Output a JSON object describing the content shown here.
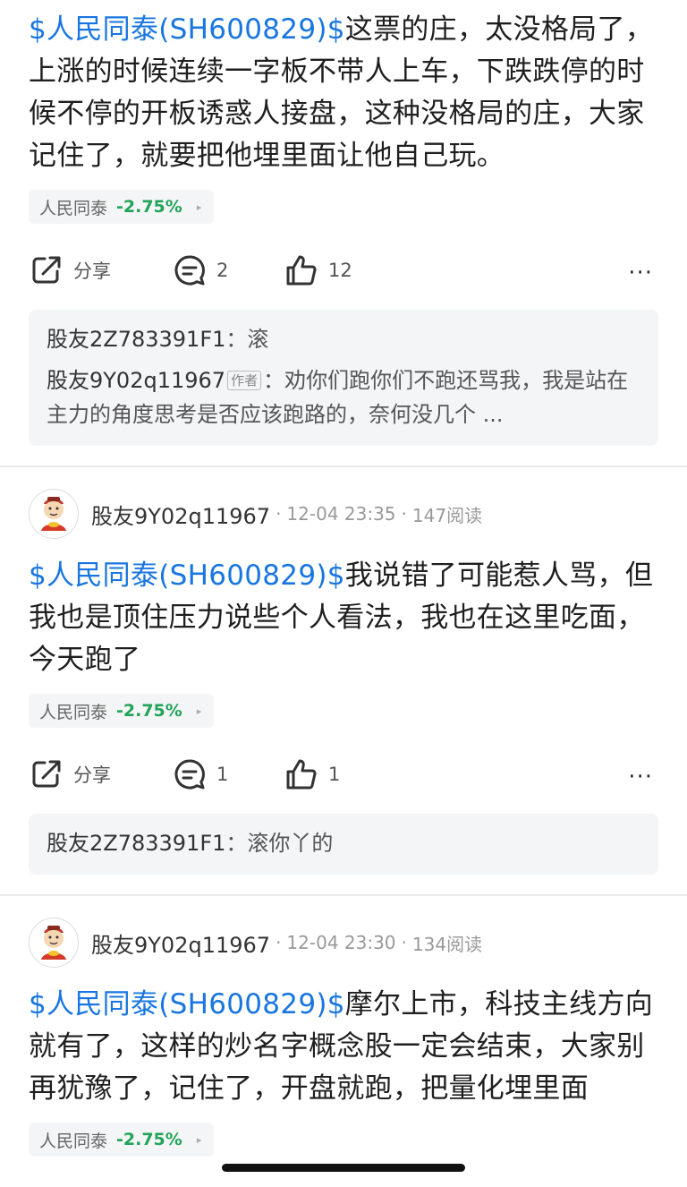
{
  "posts": [
    {
      "stock_tag": "$人民同泰(SH600829)$",
      "body": "这票的庄，太没格局了，上涨的时候连续一字板不带人上车，下跌跌停的时候不停的开板诱惑人接盘，这种没格局的庄，大家记住了，就要把他埋里面让他自己玩。",
      "chip": {
        "name": "人民同泰",
        "change": "-2.75%"
      },
      "share_label": "分享",
      "comment_count": "2",
      "like_count": "12",
      "replies": [
        {
          "name": "股友2Z783391F1",
          "sep": "：",
          "text": "滚"
        },
        {
          "name": "股友9Y02q11967",
          "tag": "作者",
          "sep": "：",
          "text": "劝你们跑你们不跑还骂我，我是站在主力的角度思考是否应该跑路的，奈何没几个 ..."
        }
      ]
    },
    {
      "user": "股友9Y02q11967",
      "time": "12-04 23:35",
      "reads": "147阅读",
      "stock_tag": "$人民同泰(SH600829)$",
      "body": "我说错了可能惹人骂，但我也是顶住压力说些个人看法，我也在这里吃面，今天跑了",
      "chip": {
        "name": "人民同泰",
        "change": "-2.75%"
      },
      "share_label": "分享",
      "comment_count": "1",
      "like_count": "1",
      "replies": [
        {
          "name": "股友2Z783391F1",
          "sep": "：",
          "text": "滚你丫的"
        }
      ]
    },
    {
      "user": "股友9Y02q11967",
      "time": "12-04 23:30",
      "reads": "134阅读",
      "stock_tag": "$人民同泰(SH600829)$",
      "body": "摩尔上市，科技主线方向就有了，这样的炒名字概念股一定会结束，大家别再犹豫了，记住了，开盘就跑，把量化埋里面",
      "chip": {
        "name": "人民同泰",
        "change": "-2.75%"
      }
    }
  ],
  "meta_sep": "·",
  "more_label": "···",
  "chip_arrow": "▸",
  "colors": {
    "link": "#1976e0",
    "down": "#22a35a"
  },
  "icons": [
    "share-icon",
    "comment-icon",
    "like-icon",
    "more-icon",
    "avatar-icon"
  ]
}
